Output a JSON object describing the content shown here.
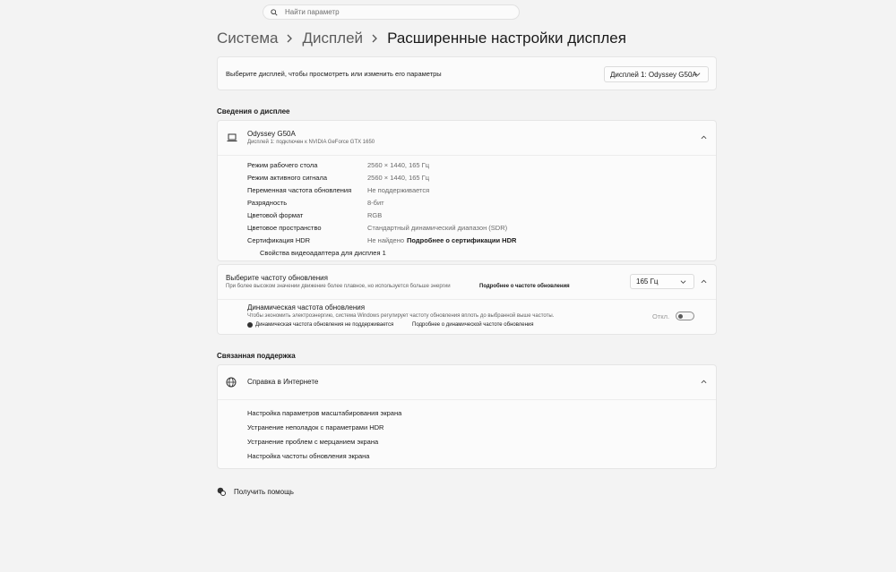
{
  "search": {
    "placeholder": "Найти параметр"
  },
  "breadcrumb": {
    "item1": "Система",
    "item2": "Дисплей",
    "current": "Расширенные настройки дисплея"
  },
  "display_select": {
    "prompt": "Выберите дисплей, чтобы просмотреть или изменить его параметры",
    "value": "Дисплей 1: Odyssey G50A"
  },
  "display_info": {
    "section_title": "Сведения о дисплее",
    "name": "Odyssey G50A",
    "subtitle": "Дисплей 1: подключен к NVIDIA GeForce GTX 1650",
    "rows": [
      {
        "label": "Режим рабочего стола",
        "value": "2560 × 1440, 165 Гц"
      },
      {
        "label": "Режим активного сигнала",
        "value": "2560 × 1440, 165 Гц"
      },
      {
        "label": "Переменная частота обновления",
        "value": "Не поддерживается"
      },
      {
        "label": "Разрядность",
        "value": "8-бит"
      },
      {
        "label": "Цветовой формат",
        "value": "RGB"
      },
      {
        "label": "Цветовое пространство",
        "value": "Стандартный динамический диапазон (SDR)"
      },
      {
        "label": "Сертификация HDR",
        "value": "Не найдено",
        "link": "Подробнее о сертификации HDR"
      }
    ],
    "adapter_link": "Свойства видеоадаптера для дисплея 1"
  },
  "refresh": {
    "title": "Выберите частоту обновления",
    "desc": "При более высоком значении движение более плавное, но используется больше энергии",
    "link": "Подробнее о частоте обновления",
    "value": "165 Гц"
  },
  "dynamic_refresh": {
    "title": "Динамическая частота обновления",
    "desc": "Чтобы экономить электроэнергию, система Windows регулирует частоту обновления вплоть до выбранной выше частоты.",
    "warning": "Динамическая частота обновления не поддерживается",
    "link": "Подробнее о динамической частоте обновления",
    "toggle_label": "Откл.",
    "toggle_on": false
  },
  "support": {
    "section_title": "Связанная поддержка",
    "header": "Справка в Интернете",
    "links": [
      "Настройка параметров масштабирования экрана",
      "Устранение неполадок с параметрами HDR",
      "Устранение проблем с мерцанием экрана",
      "Настройка частоты обновления экрана"
    ]
  },
  "help": {
    "label": "Получить помощь"
  }
}
